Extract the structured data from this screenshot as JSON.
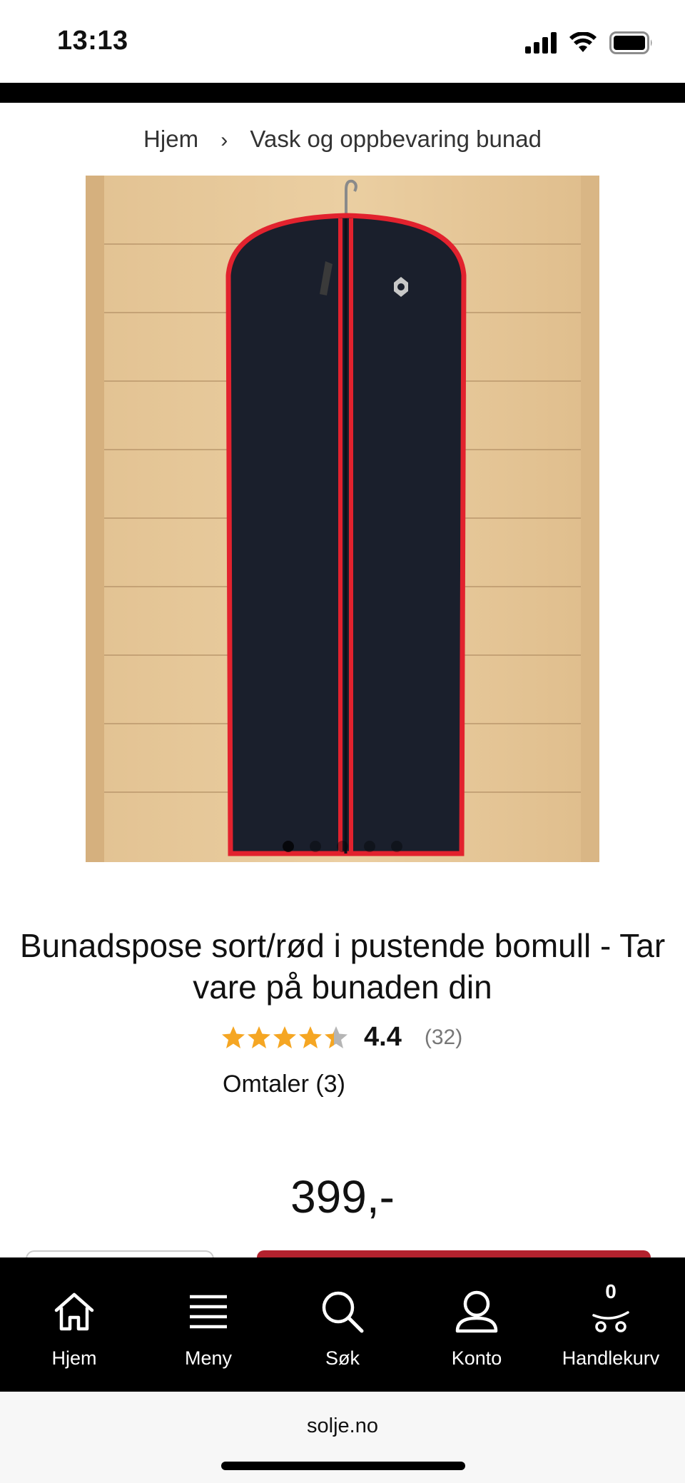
{
  "status_bar": {
    "time": "13:13",
    "icons": [
      "cellular-signal-icon",
      "wifi-icon",
      "battery-icon"
    ]
  },
  "breadcrumb": {
    "items": [
      "Hjem",
      "Vask og oppbevaring bunad"
    ],
    "separator": "›"
  },
  "product": {
    "image_alt": "Black garment bag with red trim hanging on wood wall",
    "carousel_active_index": 0,
    "carousel_count": 5,
    "title": "Bunadspose sort/rød i pustende bomull - Tar vare på bunaden din",
    "rating_value": "4.4",
    "rating_fraction": 0.88,
    "rating_count": "(32)",
    "reviews_link": "Omtaler (3)",
    "price": "399,-"
  },
  "bottom_nav": {
    "items": [
      {
        "label": "Hjem",
        "icon": "home-icon"
      },
      {
        "label": "Meny",
        "icon": "menu-icon"
      },
      {
        "label": "Søk",
        "icon": "search-icon"
      },
      {
        "label": "Konto",
        "icon": "account-icon"
      },
      {
        "label": "Handlekurv",
        "icon": "cart-icon"
      }
    ],
    "cart_count": "0"
  },
  "browser": {
    "url": "solje.no"
  },
  "colors": {
    "accent_red": "#b3222e",
    "star_gold": "#f5a623",
    "nav_background": "#000000"
  }
}
